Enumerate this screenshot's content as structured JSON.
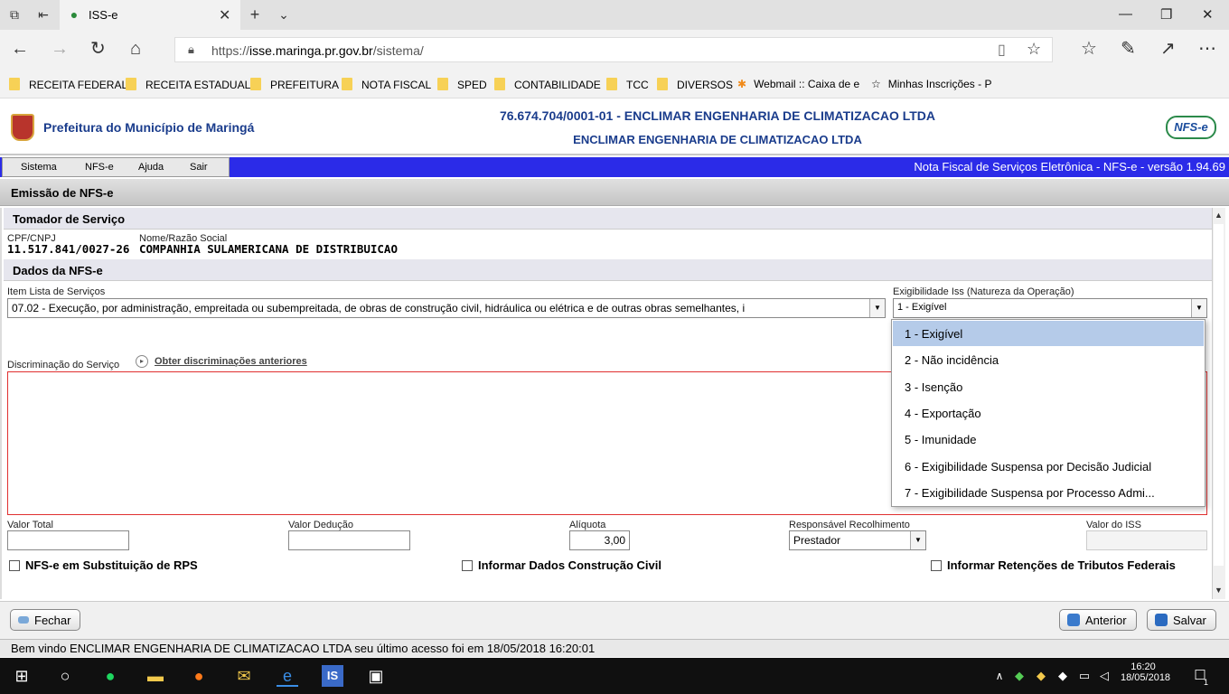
{
  "browser": {
    "tab_title": "ISS-e",
    "url_prefix": "https://",
    "url_host": "isse.maringa.pr.gov.br",
    "url_path": "/sistema/",
    "favorites": [
      "RECEITA FEDERAL",
      "RECEITA ESTADUAL",
      "PREFEITURA",
      "NOTA FISCAL",
      "SPED",
      "CONTABILIDADE",
      "TCC",
      "DIVERSOS",
      "Webmail :: Caixa de e",
      "Minhas Inscrições - P"
    ]
  },
  "header": {
    "prefeitura": "Prefeitura do Município de Maringá",
    "cnpj_title": "76.674.704/0001-01 - ENCLIMAR ENGENHARIA DE CLIMATIZACAO LTDA",
    "company": "ENCLIMAR ENGENHARIA DE CLIMATIZACAO LTDA",
    "logo_text": "NFS-e"
  },
  "menu": {
    "items": [
      "Sistema",
      "NFS-e",
      "Ajuda",
      "Sair"
    ],
    "version": "Nota Fiscal de Serviços Eletrônica - NFS-e - versão 1.94.69"
  },
  "page": {
    "title": "Emissão de NFS-e"
  },
  "tomador": {
    "section": "Tomador de Serviço",
    "cpf_label": "CPF/CNPJ",
    "cpf_value": "11.517.841/0027-26",
    "nome_label": "Nome/Razão Social",
    "nome_value": "COMPANHIA SULAMERICANA DE DISTRIBUICAO"
  },
  "dados": {
    "section": "Dados da NFS-e",
    "item_label": "Item Lista de Serviços",
    "item_value": "07.02 - Execução, por administração, empreitada ou subempreitada, de obras de construção civil, hidráulica ou elétrica e de outras obras semelhantes, i",
    "exig_label": "Exigibilidade Iss (Natureza da Operação)",
    "exig_value": "1 - Exigível",
    "discr_label": "Discriminação do Serviço",
    "discr_link": "Obter discriminações anteriores",
    "valor_total_label": "Valor Total",
    "valor_total": "",
    "valor_deducao_label": "Valor Dedução",
    "valor_deducao": "",
    "aliquota_label": "Alíquota",
    "aliquota": "3,00",
    "resp_label": "Responsável Recolhimento",
    "resp_value": "Prestador",
    "valor_iss_label": "Valor do ISS",
    "valor_iss": "",
    "chk_rps": "NFS-e em Substituição de RPS",
    "chk_construcao": "Informar Dados Construção Civil",
    "chk_retencoes": "Informar Retenções de Tributos Federais"
  },
  "dropdown": {
    "options": [
      "1 - Exigível",
      "2 - Não incidência",
      "3 - Isenção",
      "4 - Exportação",
      "5 - Imunidade",
      "6 - Exigibilidade Suspensa por Decisão Judicial",
      "7 - Exigibilidade Suspensa por Processo Admi..."
    ],
    "selected_index": 0
  },
  "footer": {
    "fechar": "Fechar",
    "anterior": "Anterior",
    "salvar": "Salvar",
    "status": "Bem vindo ENCLIMAR ENGENHARIA DE CLIMATIZACAO LTDA seu último acesso foi em 18/05/2018 16:20:01"
  },
  "taskbar": {
    "time": "16:20",
    "date": "18/05/2018",
    "notif_count": "1"
  }
}
